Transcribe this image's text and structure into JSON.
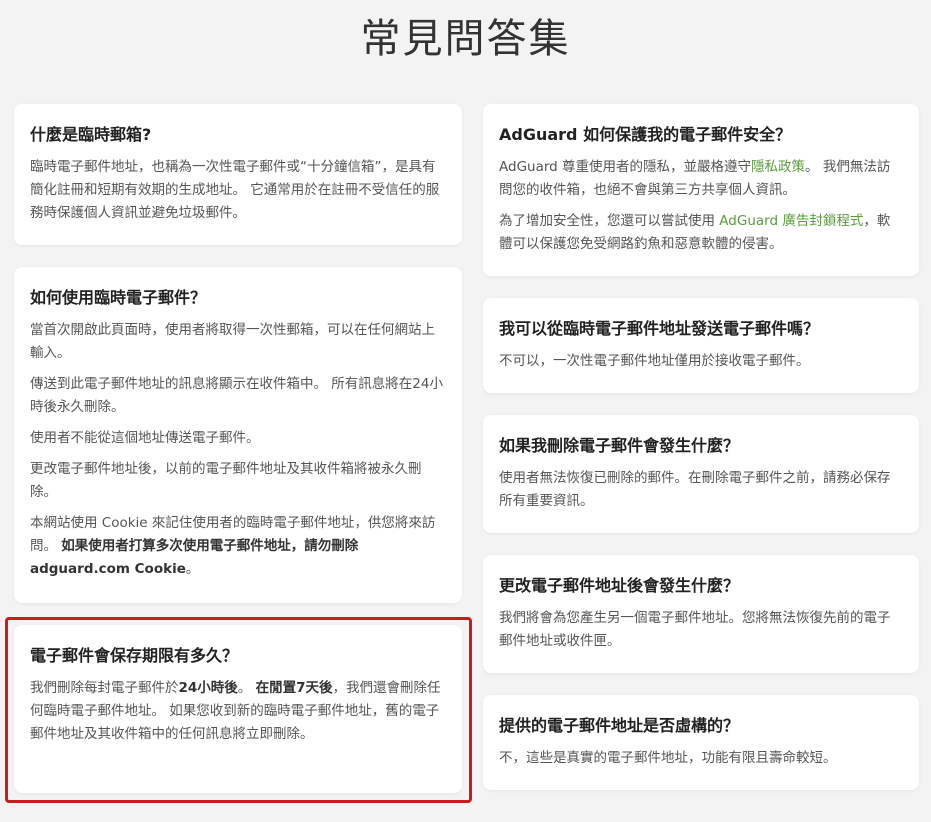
{
  "page": {
    "title": "常見問答集"
  },
  "left": [
    {
      "q": "什麼是臨時郵箱?",
      "paras": [
        "臨時電子郵件地址，也稱為一次性電子郵件或“十分鐘信箱”，是具有簡化註冊和短期有效期的生成地址。 它通常用於在註冊不受信任的服務時保護個人資訊並避免垃圾郵件。"
      ]
    },
    {
      "q": "如何使用臨時電子郵件？",
      "paras": [
        "當首次開啟此頁面時，使用者將取得一次性郵箱，可以在任何網站上輸入。",
        "傳送到此電子郵件地址的訊息將顯示在收件箱中。 所有訊息將在24小時後永久刪除。",
        "使用者不能從這個地址傳送電子郵件。",
        "更改電子郵件地址後，以前的電子郵件地址及其收件箱將被永久刪除。"
      ],
      "cookie_para": {
        "text": "本網站使用 Cookie 來記住使用者的臨時電子郵件地址，供您將來訪問。",
        "bold": "如果使用者打算多次使用電子郵件地址，請勿刪除 adguard.com Cookie",
        "end": "。"
      }
    },
    {
      "q": "電子郵件會保存期限有多久？",
      "p_a": "我們刪除每封電子郵件於",
      "p_b": "24小時後",
      "p_c": "。",
      "p_d": "在閒置7天後",
      "p_e": "，我們還會刪除任何臨時電子郵件地址。 如果您收到新的臨時電子郵件地址，舊的電子郵件地址及其收件箱中的任何訊息將立即刪除。"
    }
  ],
  "right": [
    {
      "q": "AdGuard 如何保護我的電子郵件安全？",
      "p1_a": "AdGuard 尊重使用者的隱私，並嚴格遵守",
      "p1_link": "隱私政策",
      "p1_b": "。 我們無法訪問您的收件箱，也絕不會與第三方共享個人資訊。",
      "p2_a": "為了增加安全性，您還可以嘗試使用 ",
      "p2_link": "AdGuard 廣告封鎖程式",
      "p2_b": "，軟體可以保護您免受網路釣魚和惡意軟體的侵害。"
    },
    {
      "q": "我可以從臨時電子郵件地址發送電子郵件嗎？",
      "p": "不可以，一次性電子郵件地址僅用於接收電子郵件。"
    },
    {
      "q": "如果我刪除電子郵件會發生什麼？",
      "p": "使用者無法恢復已刪除的郵件。在刪除電子郵件之前，請務必保存所有重要資訊。"
    },
    {
      "q": "更改電子郵件地址後會發生什麼？",
      "p": "我們將會為您產生另一個電子郵件地址。您將無法恢復先前的電子郵件地址或收件匣。"
    },
    {
      "q": "提供的電子郵件地址是否虛構的？",
      "p": "不，這些是真實的電子郵件地址，功能有限且壽命較短。"
    }
  ]
}
